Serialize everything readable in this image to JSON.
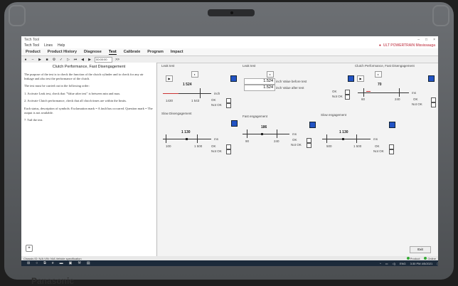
{
  "window": {
    "title": "Tech Tool"
  },
  "menu": {
    "items": [
      "Tech Tool",
      "Lines",
      "Help"
    ],
    "user": "ULT POWERTRAIN Mississauga"
  },
  "tabs": [
    "Product",
    "Product History",
    "Diagnose",
    "Test",
    "Calibrate",
    "Program",
    "Impact"
  ],
  "toolbar": {
    "field_value": "00:00:00",
    "nav": ">>"
  },
  "left_panel": {
    "heading": "Clutch Performance, Fast Disengagement",
    "paragraphs": [
      "The purpose of the test is to check the function of the clutch cylinder and to check for any air leakage and also test the performance of the clutch.",
      "The test must be carried out in the following order:",
      "1. Activate Leak test, check that \"Value after test\" is between min and max.",
      "2. Activate Clutch performance, check that all clutch times are within the limits.",
      "Each status, description of symbols: Exclamation mark = A fault has occurred. Question mark = The output is not available.",
      "7. Tail the test."
    ]
  },
  "leak_test": {
    "title": "Leak test",
    "value": "1 524",
    "unit": "inch",
    "min": "1430",
    "max": "1 543",
    "ok": "OK",
    "not_ok": "Not OK"
  },
  "leak_test_2": {
    "title": "Leak test",
    "before_value": "1.524",
    "before_label": "inch  Value before test",
    "after_value": "1.524",
    "after_label": "inch  Value after test"
  },
  "clutch_perf": {
    "title": "Clutch Performance, Fast Disengagement",
    "value": "70",
    "unit": "ms",
    "min": "60",
    "max": "240",
    "ok": "OK",
    "not_ok": "Not OK"
  },
  "slow_disengagement": {
    "title": "Slow Disengagement",
    "value": "1 130",
    "unit": "ms",
    "min": "100",
    "max": "1 500",
    "ok": "OK",
    "not_ok": "Not OK"
  },
  "fast_engagement": {
    "title": "Fast engagement",
    "value": "186",
    "unit": "ms",
    "min": "90",
    "max": "240",
    "ok": "OK",
    "not_ok": "Not OK"
  },
  "slow_engagement": {
    "title": "Slow engagement",
    "value": "1 130",
    "unit": "ms",
    "min": "500",
    "max": "1 500",
    "ok": "OK",
    "not_ok": "Not OK"
  },
  "middle_ok": {
    "ok": "OK",
    "not_ok": "Not OK"
  },
  "buttons": {
    "exit": "Exit"
  },
  "status_bar": {
    "left": "Chassis ID: N/A  VIN: N/A  Vehicle specification",
    "online": "Product",
    "connect": "Online"
  },
  "taskbar": {
    "lang": "ENG",
    "time": "3:30 PM",
    "date": "4/5/2021"
  },
  "laptop": {
    "brand": "Panasonic"
  },
  "colors": {
    "accent": "#2253c4",
    "marker": "#c33333",
    "status_ok": "#33aa33"
  }
}
